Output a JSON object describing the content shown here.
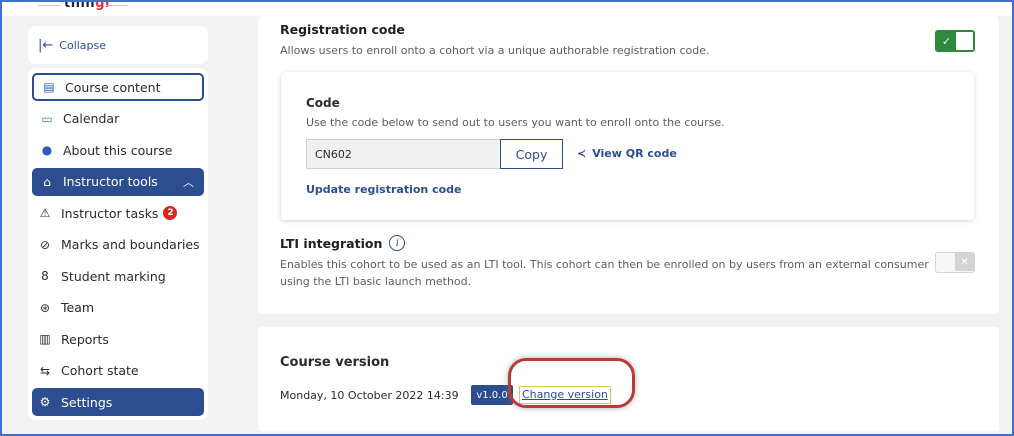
{
  "app": {
    "logo_text": "thin",
    "logo_accent": "gi"
  },
  "sidebar": {
    "collapse_label": "Collapse",
    "items": [
      {
        "label": "Course content",
        "icon": "book-icon"
      },
      {
        "label": "Calendar",
        "icon": "calendar-icon"
      },
      {
        "label": "About this course",
        "icon": "info-icon"
      }
    ],
    "section": {
      "label": "Instructor tools",
      "icon": "graduation-cap-icon"
    },
    "sub_items": [
      {
        "label": "Instructor tasks",
        "icon": "warning-icon",
        "badge": "2"
      },
      {
        "label": "Marks and boundaries",
        "icon": "check-circle-icon"
      },
      {
        "label": "Student marking",
        "icon": "person-icon"
      },
      {
        "label": "Team",
        "icon": "team-icon"
      },
      {
        "label": "Reports",
        "icon": "bar-chart-icon"
      },
      {
        "label": "Cohort state",
        "icon": "state-icon"
      },
      {
        "label": "Settings",
        "icon": "gear-icon"
      }
    ]
  },
  "registration": {
    "title": "Registration code",
    "description": "Allows users to enroll onto a cohort via a unique authorable registration code.",
    "enabled": true,
    "code_title": "Code",
    "code_description": "Use the code below to send out to users you want to enroll onto the course.",
    "code_value": "CN602",
    "copy_label": "Copy",
    "qr_label": "View QR code",
    "update_label": "Update registration code"
  },
  "lti": {
    "title": "LTI integration",
    "description": "Enables this cohort to be used as an LTI tool. This cohort can then be enrolled on by users from an external consumer using the LTI basic launch method.",
    "enabled": false
  },
  "course_version": {
    "title": "Course version",
    "date": "Monday, 10 October 2022 14:39",
    "version": "v1.0.0",
    "change_label": "Change version"
  },
  "colors": {
    "brand": "#2c4d8f",
    "logo_accent": "#e0362c",
    "toggle_on": "#2d8a3a",
    "highlight": "#b73d32",
    "badge": "#d9261c"
  }
}
